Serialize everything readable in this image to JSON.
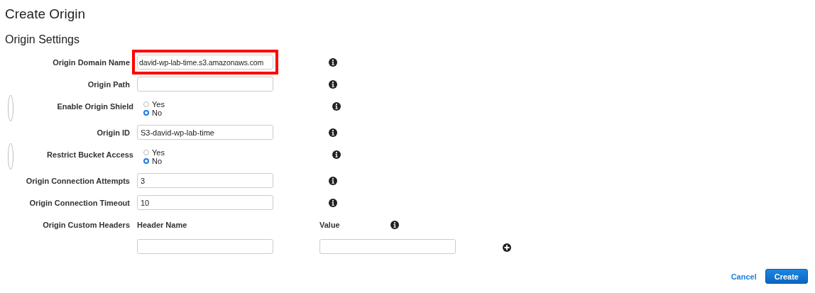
{
  "page_title": "Create Origin",
  "section_title": "Origin Settings",
  "fields": [
    {
      "kind": "text",
      "label": "Origin Domain Name",
      "value": "david-wp-lab-time.s3.amazonaws.com",
      "highlighted": true
    },
    {
      "kind": "text",
      "label": "Origin Path",
      "highlighted": false
    },
    {
      "kind": "radio",
      "label": "Enable Origin Shield",
      "options": [
        {
          "label": "Yes",
          "selected": false
        },
        {
          "label": "No",
          "selected": true
        }
      ]
    },
    {
      "kind": "text",
      "label": "Origin ID",
      "value": "S3-david-wp-lab-time",
      "highlighted": false
    },
    {
      "kind": "radio",
      "label": "Restrict Bucket Access",
      "options": [
        {
          "label": "Yes",
          "selected": false
        },
        {
          "label": "No",
          "selected": true
        }
      ]
    },
    {
      "kind": "text",
      "label": "Origin Connection Attempts",
      "value": "3",
      "highlighted": false
    },
    {
      "kind": "text",
      "label": "Origin Connection Timeout",
      "value": "10",
      "highlighted": false
    }
  ],
  "custom_headers": {
    "label": "Origin Custom Headers",
    "header_name_label": "Header Name",
    "value_label": "Value"
  },
  "buttons": {
    "cancel": "Cancel",
    "create": "Create"
  }
}
